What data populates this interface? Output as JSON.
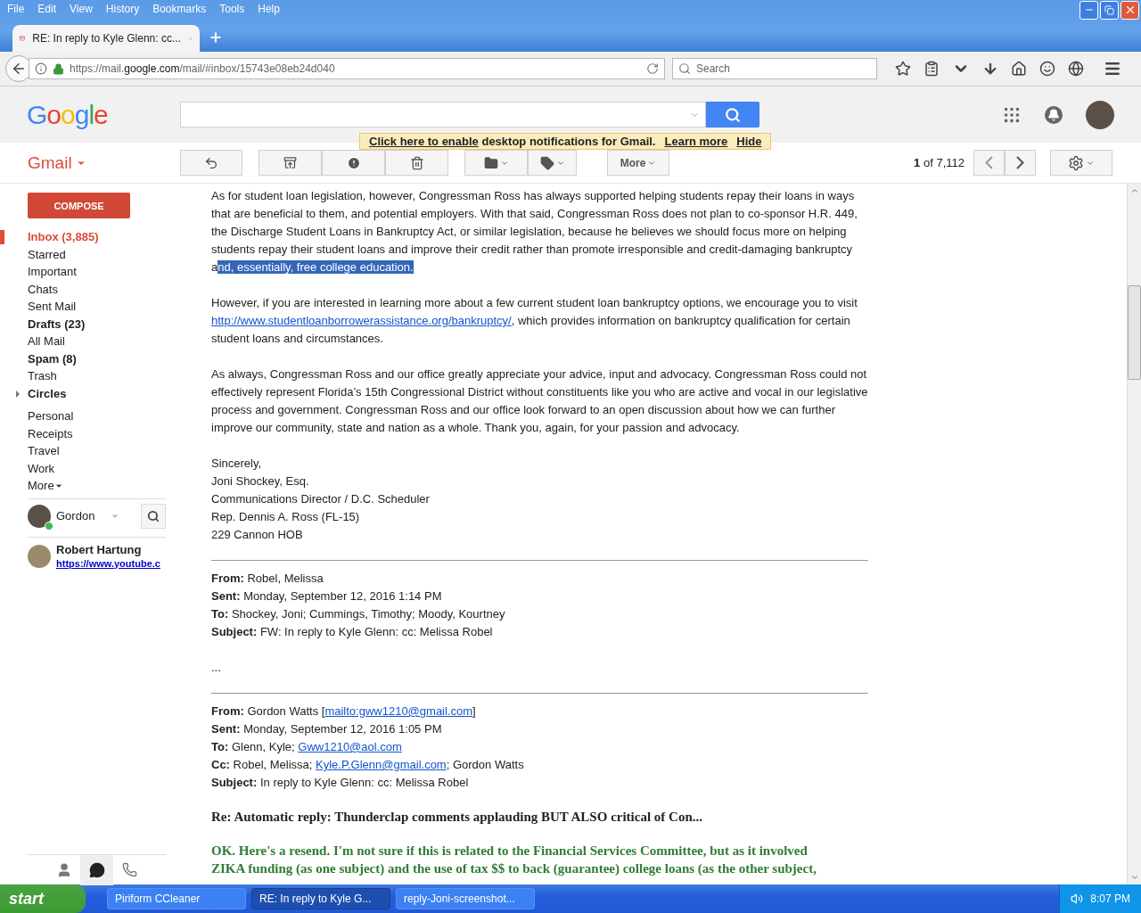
{
  "menu": [
    "File",
    "Edit",
    "View",
    "History",
    "Bookmarks",
    "Tools",
    "Help"
  ],
  "tab": {
    "title": "RE: In reply to Kyle Glenn: cc..."
  },
  "address": {
    "prefix": "https://mail.",
    "domain": "google.com",
    "path": "/mail/#inbox/15743e08eb24d040"
  },
  "browser_search": {
    "placeholder": "Search"
  },
  "logo": "Google",
  "notification": {
    "link": "Click here to enable",
    "text": "desktop notifications for Gmail.",
    "learn_more": "Learn more",
    "hide": "Hide"
  },
  "gmail_menu": "Gmail",
  "toolbar": {
    "more": "More",
    "pager_current": "1",
    "pager_rest": "of 7,112"
  },
  "compose": "COMPOSE",
  "folders": [
    {
      "label": "Inbox (3,885)",
      "selected": true,
      "unread": true
    },
    {
      "label": "Starred",
      "selected": false,
      "unread": false
    },
    {
      "label": "Important",
      "selected": false,
      "unread": false
    },
    {
      "label": "Chats",
      "selected": false,
      "unread": false
    },
    {
      "label": "Sent Mail",
      "selected": false,
      "unread": false
    },
    {
      "label": "Drafts (23)",
      "selected": false,
      "unread": true
    },
    {
      "label": "All Mail",
      "selected": false,
      "unread": false
    },
    {
      "label": "Spam (8)",
      "selected": false,
      "unread": true
    },
    {
      "label": "Trash",
      "selected": false,
      "unread": false
    },
    {
      "label": "Circles",
      "selected": false,
      "unread": true,
      "expanded": false
    }
  ],
  "labels": [
    "Personal",
    "Receipts",
    "Travel",
    "Work"
  ],
  "more_labels": "More",
  "chat": {
    "user": "Gordon",
    "online": true
  },
  "contacts": [
    {
      "name": "Robert Hartung",
      "status": "https://www.youtube.c"
    }
  ],
  "message": {
    "paragraphs": [
      {
        "segments": [
          {
            "text": "As for student loan legislation, however, Congressman Ross has always supported helping students repay their loans in ways that are beneficial to them, and potential employers. With that said, Congressman Ross does not plan to co-sponsor H.R. 449, the Discharge Student Loans in Bankruptcy Act, or similar legislation, because he believes we should focus more on helping students repay their student loans and improve their credit rather than promote irresponsible and credit-damaging bankruptcy a",
            "highlighted": false
          },
          {
            "text": "nd, essentially, free college education.",
            "highlighted": true
          }
        ]
      },
      {
        "segments": [
          {
            "text": "However, if you are interested in learning more about a few current student loan bankruptcy options, we encourage you to visit "
          },
          {
            "text": "http://www.studentloanborrowerassistance.org/bankruptcy/",
            "link": true
          },
          {
            "text": ", which provides information on bankruptcy qualification for certain student loans and circumstances."
          }
        ]
      },
      {
        "segments": [
          {
            "text": "As always, Congressman Ross and our office greatly appreciate your advice, input and advocacy. Congressman Ross could not effectively represent Florida’s 15th Congressional District without constituents like you who are active and vocal in our legislative process and government. Congressman Ross and our office look forward to an open discussion about how we can further improve our community, state and nation as a whole. Thank you, again, for your passion and advocacy."
          }
        ]
      }
    ],
    "signature": [
      "Sincerely,",
      "Joni Shockey, Esq.",
      "Communications Director / D.C. Scheduler",
      "Rep. Dennis A. Ross (FL-15)",
      "229 Cannon HOB"
    ],
    "forwards": [
      {
        "headers": [
          {
            "label": "From:",
            "segments": [
              {
                "text": "Robel, Melissa"
              }
            ]
          },
          {
            "label": "Sent:",
            "segments": [
              {
                "text": "Monday, September 12, 2016 1:14 PM"
              }
            ]
          },
          {
            "label": "To:",
            "segments": [
              {
                "text": "Shockey, Joni; Cummings, Timothy; Moody, Kourtney"
              }
            ]
          },
          {
            "label": "Subject:",
            "segments": [
              {
                "text": "FW: In reply to Kyle Glenn: cc: Melissa Robel"
              }
            ]
          }
        ],
        "ellipsis": "..."
      },
      {
        "headers": [
          {
            "label": "From:",
            "segments": [
              {
                "text": "Gordon Watts ["
              },
              {
                "text": "mailto:gww1210@gmail.com",
                "link": true
              },
              {
                "text": "]"
              }
            ]
          },
          {
            "label": "Sent:",
            "segments": [
              {
                "text": "Monday, September 12, 2016 1:05 PM"
              }
            ]
          },
          {
            "label": "To:",
            "segments": [
              {
                "text": "Glenn, Kyle; "
              },
              {
                "text": "Gww1210@aol.com",
                "link": true
              }
            ]
          },
          {
            "label": "Cc:",
            "segments": [
              {
                "text": "Robel, Melissa; "
              },
              {
                "text": "Kyle.P.Glenn@gmail.com",
                "link": true
              },
              {
                "text": "; Gordon Watts"
              }
            ]
          },
          {
            "label": "Subject:",
            "segments": [
              {
                "text": "In reply to Kyle Glenn: cc: Melissa Robel"
              }
            ]
          }
        ]
      }
    ],
    "quoted_subject": "Re: Automatic reply: Thunderclap comments applauding BUT ALSO critical of Con...",
    "quoted_body": "OK. Here's a resend. I'm not sure if this is related to the Financial Services Committee, but as it involved ZIKA funding (as one subject) and the use of tax $$ to back (guarantee) college loans (as the other subject,"
  },
  "taskbar": {
    "start": "start",
    "tasks": [
      {
        "label": "Piriform CCleaner",
        "selected": false
      },
      {
        "label": "RE: In reply to Kyle G...",
        "selected": true
      },
      {
        "label": "reply-Joni-screenshot...",
        "selected": false
      }
    ],
    "clock": "8:07 PM"
  }
}
